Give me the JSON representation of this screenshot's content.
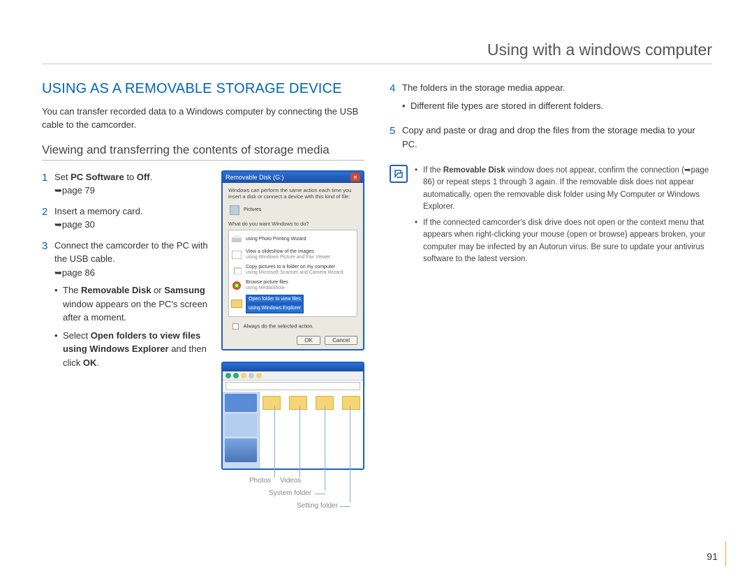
{
  "header": {
    "title": "Using with a windows computer"
  },
  "section": {
    "title": "USING AS A REMOVABLE STORAGE DEVICE",
    "intro": "You can transfer recorded data to a Windows computer by connecting the USB cable to the camcorder.",
    "subheading": "Viewing and transferring the contents of storage media"
  },
  "left_steps": {
    "s1": {
      "num": "1",
      "pre": "Set ",
      "bold1": "PC Software",
      "mid": " to ",
      "bold2": "Off",
      "post": ".",
      "ref": "➥page 79"
    },
    "s2": {
      "num": "2",
      "text": "Insert a memory card.",
      "ref": "➥page 30"
    },
    "s3": {
      "num": "3",
      "text": "Connect the camcorder to the PC with the USB cable.",
      "ref": "➥page 86",
      "b1": {
        "pre": "The ",
        "bold1": "Removable Disk",
        "mid": " or ",
        "bold2": "Samsung",
        "post": " window appears on the PC's screen after a moment."
      },
      "b2": {
        "pre": "Select ",
        "bold1": "Open folders to view files using Windows Explorer",
        "mid": " and then click ",
        "bold2": "OK",
        "post": "."
      }
    }
  },
  "right_steps": {
    "s4": {
      "num": "4",
      "text": "The folders in the storage media appear.",
      "b1": "Different file types are stored in different folders."
    },
    "s5": {
      "num": "5",
      "text": "Copy and paste or drag and drop the files from the storage media to your PC."
    }
  },
  "notes": {
    "n1": {
      "pre": "If the ",
      "bold": "Removable Disk",
      "post": " window does not appear, confirm the connection (➥page 86) or repeat steps 1 through 3 again. If the removable disk does not appear automatically, open the removable disk folder using My Computer or Windows Explorer."
    },
    "n2": "If the connected camcorder's disk drive does not open or the context menu that appears when right-clicking your mouse (open or browse) appears broken, your computer may be infected by an Autorun virus. Be sure to update your antivirus software to the latest version."
  },
  "dialog": {
    "title": "Removable Disk (G:)",
    "line1": "Windows can perform the same action each time you insert a disk or connect a device with this kind of file:",
    "pictures": "Pictures",
    "question": "What do you want Windows to do?",
    "opt1_t": "using Photo Printing Wizard",
    "opt2_t": "View a slideshow of the images",
    "opt2_s": "using Windows Picture and Fax Viewer",
    "opt3_t": "Copy pictures to a folder on my computer",
    "opt3_s": "using Microsoft Scanner and Camera Wizard",
    "opt4_t": "Browse picture files",
    "opt4_s": "using MediaShow",
    "opt5_t": "Open folder to view files",
    "opt5_s": "using Windows Explorer",
    "always": "Always do the selected action.",
    "ok": "OK",
    "cancel": "Cancel"
  },
  "callouts": {
    "photos": "Photos",
    "videos": "Videos",
    "system": "System folder",
    "setting": "Setting folder"
  },
  "page_number": "91"
}
